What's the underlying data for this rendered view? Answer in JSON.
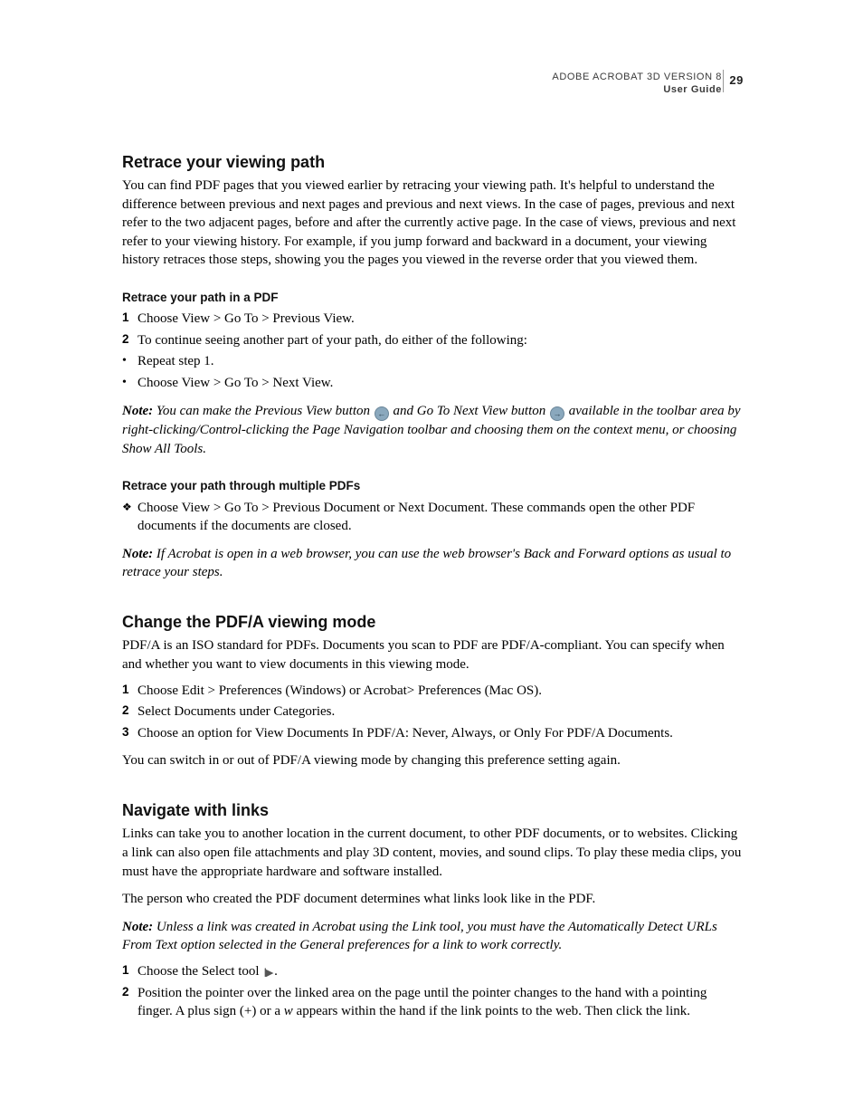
{
  "header": {
    "product": "ADOBE ACROBAT 3D VERSION 8",
    "doc_type": "User Guide",
    "page_number": "29"
  },
  "sections": {
    "s1": {
      "title": "Retrace your viewing path",
      "intro": "You can find PDF pages that you viewed earlier by retracing your viewing path. It's helpful to understand the difference between previous and next pages and previous and next views. In the case of pages, previous and next refer to the two adjacent pages, before and after the currently active page. In the case of views, previous and next refer to your viewing history. For example, if you jump forward and backward in a document, your viewing history retraces those steps, showing you the pages you viewed in the reverse order that you viewed them.",
      "sub1": {
        "title": "Retrace your path in a PDF",
        "step1": "Choose View > Go To > Previous View.",
        "step2": "To continue seeing another part of your path, do either of the following:",
        "bullet1": "Repeat step 1.",
        "bullet2": "Choose View > Go To > Next View.",
        "note_label": "Note:",
        "note_a": "You can make the Previous View button ",
        "note_b": " and Go To Next View button ",
        "note_c": " available in the toolbar area by right-clicking/Control-clicking the Page Navigation toolbar and choosing them on the context menu, or choosing Show All Tools."
      },
      "sub2": {
        "title": "Retrace your path through multiple PDFs",
        "diamond": "Choose View > Go To > Previous Document or Next Document. These commands open the other PDF documents if the documents are closed.",
        "note_label": "Note:",
        "note": "If Acrobat is open in a web browser, you can use the web browser's Back and Forward options as usual to retrace your steps."
      }
    },
    "s2": {
      "title": "Change the PDF/A viewing mode",
      "intro": "PDF/A is an ISO standard for PDFs. Documents you scan to PDF are PDF/A-compliant. You can specify when and whether you want to view documents in this viewing mode.",
      "step1": "Choose Edit > Preferences (Windows) or Acrobat> Preferences (Mac OS).",
      "step2": "Select Documents under Categories.",
      "step3": "Choose an option for View Documents In PDF/A: Never, Always, or Only For PDF/A Documents.",
      "outro": "You can switch in or out of PDF/A viewing mode by changing this preference setting again."
    },
    "s3": {
      "title": "Navigate with links",
      "p1": "Links can take you to another location in the current document, to other PDF documents, or to websites. Clicking a link can also open file attachments and play 3D content, movies, and sound clips. To play these media clips, you must have the appropriate hardware and software installed.",
      "p2": "The person who created the PDF document determines what links look like in the PDF.",
      "note_label": "Note:",
      "note": "Unless a link was created in Acrobat using the Link tool, you must have the Automatically Detect URLs From Text option selected in the General preferences for a link to work correctly.",
      "step1_a": "Choose the Select tool ",
      "step1_b": ".",
      "step2_a": "Position the pointer over the linked area on the page until the pointer changes to the hand with a pointing finger. A plus sign (+) or a ",
      "step2_w": "w",
      "step2_b": " appears within the hand if the link points to the web. Then click the link."
    }
  },
  "list_markers": {
    "n1": "1",
    "n2": "2",
    "n3": "3",
    "bullet": "•",
    "diamond": "❖"
  },
  "icons": {
    "prev_arrow": "←",
    "next_arrow": "→",
    "select_tool": "I►"
  }
}
